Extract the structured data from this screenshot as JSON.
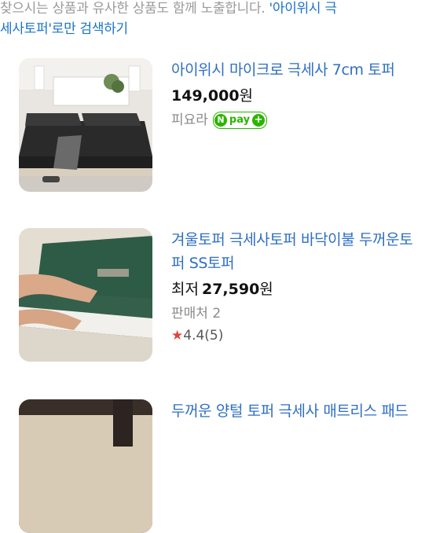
{
  "notice": {
    "prefix": "찾으시는 상품과 유사한 상품도 함께 노출합니다. ",
    "query_line1": "'아이위시 극",
    "query_line2": "세사토퍼'",
    "suffix": "로만 검색하기"
  },
  "products": [
    {
      "title": "아이위시 마이크로 극세사 7cm 토퍼",
      "price": "149,000",
      "currency": "원",
      "seller": "피요라",
      "npay_label": "pay"
    },
    {
      "title": "겨울토퍼 극세사토퍼 바닥이불 두꺼운토퍼 SS토퍼",
      "price_prefix": "최저",
      "price": "27,590",
      "currency": "원",
      "seller": "판매처 2",
      "rating": "4.4",
      "review_count": "(5)"
    },
    {
      "title": "두꺼운 양털 토퍼 극세사 매트리스 패드"
    }
  ],
  "colors": {
    "link": "#2f6fc2",
    "npay_green": "#2db400",
    "star_red": "#e0443c"
  }
}
